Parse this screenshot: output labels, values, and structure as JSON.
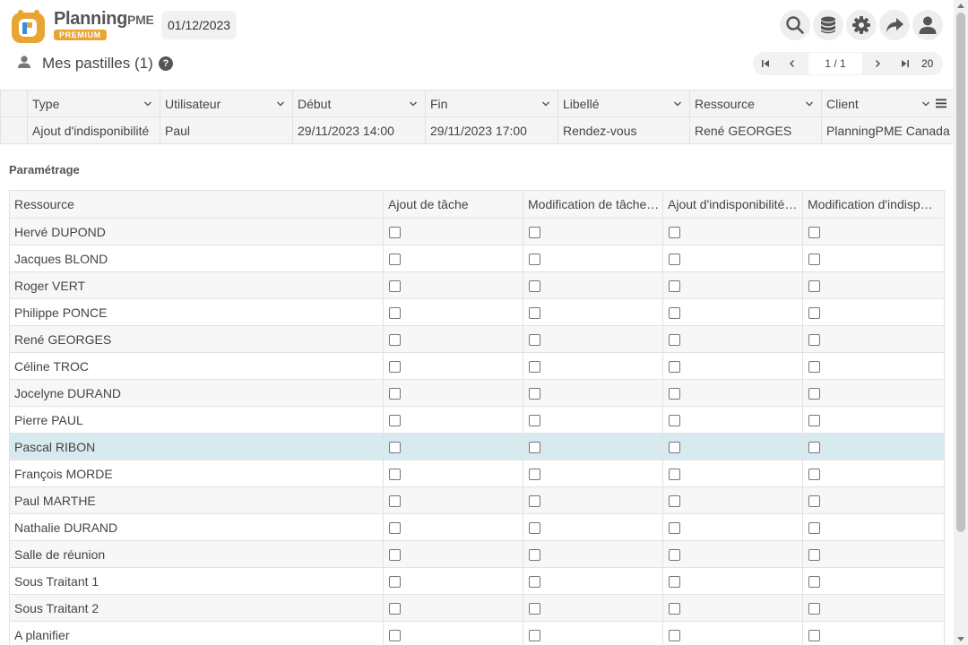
{
  "app": {
    "logo_text": "Planning",
    "logo_text_small": "PME",
    "logo_badge": "PREMIUM",
    "current_date": "01/12/2023",
    "header_icons": [
      "search-icon",
      "database-icon",
      "gear-icon",
      "share-icon",
      "user-icon"
    ]
  },
  "title": {
    "text": "Mes pastilles (1)",
    "help": "?"
  },
  "pager": {
    "page": "1 / 1",
    "page_size": "20"
  },
  "top_grid": {
    "columns": [
      "Type",
      "Utilisateur",
      "Début",
      "Fin",
      "Libellé",
      "Ressource",
      "Client"
    ],
    "rows": [
      [
        "Ajout d'indisponibilité",
        "Paul",
        "29/11/2023 14:00",
        "29/11/2023 17:00",
        "Rendez-vous",
        "René GEORGES",
        "PlanningPME Canada"
      ]
    ]
  },
  "settings": {
    "label": "Paramétrage",
    "columns": [
      "Ressource",
      "Ajout de tâche",
      "Modification de tâche…",
      "Ajout d'indisponibilité…",
      "Modification d'indisp…"
    ],
    "rows": [
      "Hervé DUPOND",
      "Jacques BLOND",
      "Roger VERT",
      "Philippe PONCE",
      "René GEORGES",
      "Céline TROC",
      "Jocelyne DURAND",
      "Pierre PAUL",
      "Pascal RIBON",
      "François MORDE",
      "Paul MARTHE",
      "Nathalie DURAND",
      "Salle de réunion",
      "Sous Traitant 1",
      "Sous Traitant 2",
      "A planifier"
    ],
    "selected_row": "Pascal RIBON"
  },
  "colors": {
    "accent": "#e8a534",
    "selected_row": "#d7eaef"
  }
}
